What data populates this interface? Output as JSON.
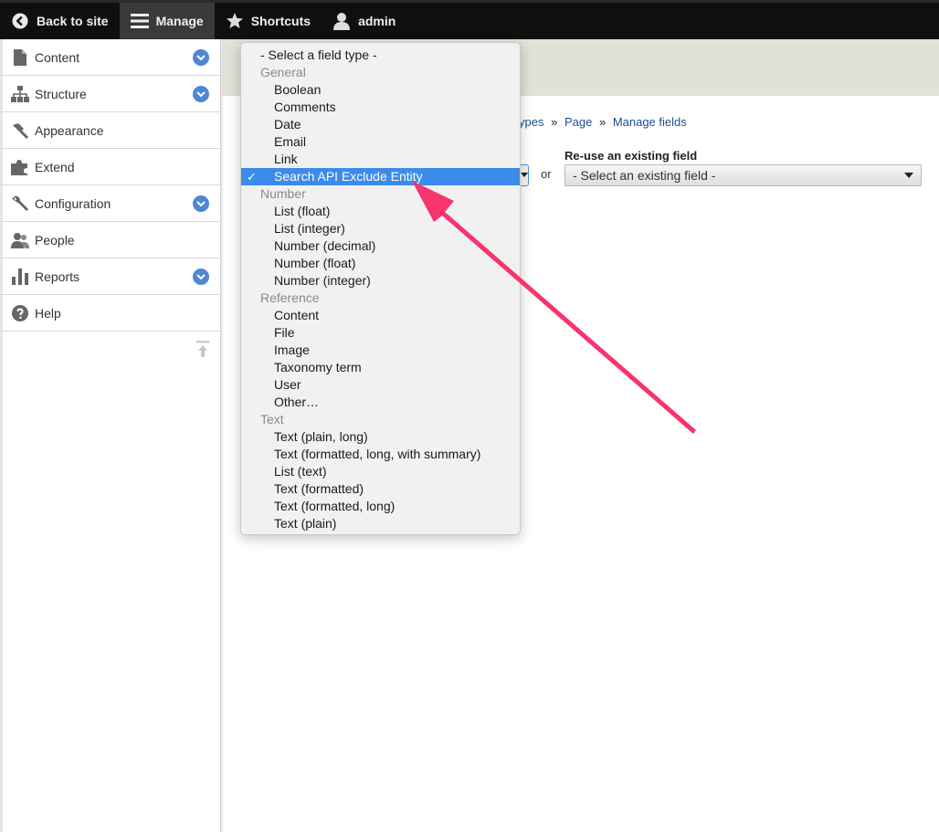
{
  "toolbar": {
    "back_label": "Back to site",
    "manage_label": "Manage",
    "shortcuts_label": "Shortcuts",
    "user_label": "admin"
  },
  "sidebar": {
    "items": [
      {
        "label": "Content",
        "icon": "file-icon",
        "expandable": true
      },
      {
        "label": "Structure",
        "icon": "sitemap-icon",
        "expandable": true
      },
      {
        "label": "Appearance",
        "icon": "paintbrush-icon",
        "expandable": false
      },
      {
        "label": "Extend",
        "icon": "puzzle-icon",
        "expandable": false
      },
      {
        "label": "Configuration",
        "icon": "wrench-icon",
        "expandable": true
      },
      {
        "label": "People",
        "icon": "people-icon",
        "expandable": false
      },
      {
        "label": "Reports",
        "icon": "bar-chart-icon",
        "expandable": true
      },
      {
        "label": "Help",
        "icon": "help-icon",
        "expandable": false
      }
    ]
  },
  "breadcrumb": {
    "partial": "ypes",
    "page": "Page",
    "current": "Manage fields",
    "separator": "»"
  },
  "form": {
    "or_text": "or",
    "reuse_label": "Re-use an existing field",
    "reuse_selected": "- Select an existing field -"
  },
  "dropdown": {
    "placeholder": "- Select a field type -",
    "check_mark": "✓",
    "groups": [
      {
        "label": "General",
        "options": [
          "Boolean",
          "Comments",
          "Date",
          "Email",
          "Link",
          "Search API Exclude Entity"
        ]
      },
      {
        "label": "Number",
        "options": [
          "List (float)",
          "List (integer)",
          "Number (decimal)",
          "Number (float)",
          "Number (integer)"
        ]
      },
      {
        "label": "Reference",
        "options": [
          "Content",
          "File",
          "Image",
          "Taxonomy term",
          "User",
          "Other…"
        ]
      },
      {
        "label": "Text",
        "options": [
          "Text (plain, long)",
          "Text (formatted, long, with summary)",
          "List (text)",
          "Text (formatted)",
          "Text (formatted, long)",
          "Text (plain)"
        ]
      }
    ],
    "selected": "Search API Exclude Entity"
  },
  "colors": {
    "accent": "#3b8bea",
    "annotation_arrow": "#f7346b",
    "toolbar_bg": "#0f0f0f",
    "chevron": "#4f86d4"
  }
}
